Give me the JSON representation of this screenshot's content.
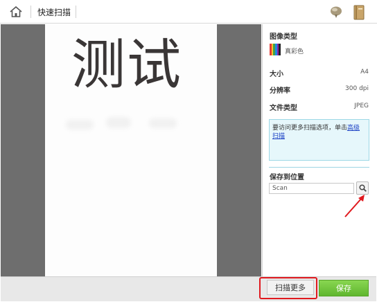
{
  "header": {
    "title": "快速扫描"
  },
  "preview": {
    "document_text": "测试"
  },
  "settings": {
    "image_type": {
      "label": "图像类型",
      "value": "真彩色"
    },
    "size": {
      "label": "大小",
      "value": "A4"
    },
    "resolution": {
      "label": "分辨率",
      "value": "300 dpi"
    },
    "file_type": {
      "label": "文件类型",
      "value": "JPEG"
    },
    "info": {
      "text": "要访问更多扫描选项，单击",
      "link_text": "高级扫描"
    },
    "save_location": {
      "label": "保存到位置",
      "value": "Scan"
    }
  },
  "footer": {
    "scan_more_label": "扫描更多",
    "save_label": "保存"
  },
  "colors": {
    "accent_green": "#6cc13a",
    "annotation_red": "#e0191e",
    "info_bg": "#e6f7fb"
  },
  "icons": [
    "home-icon",
    "help-bubble-icon",
    "manual-book-icon",
    "true-color-swatch-icon",
    "search-icon"
  ]
}
